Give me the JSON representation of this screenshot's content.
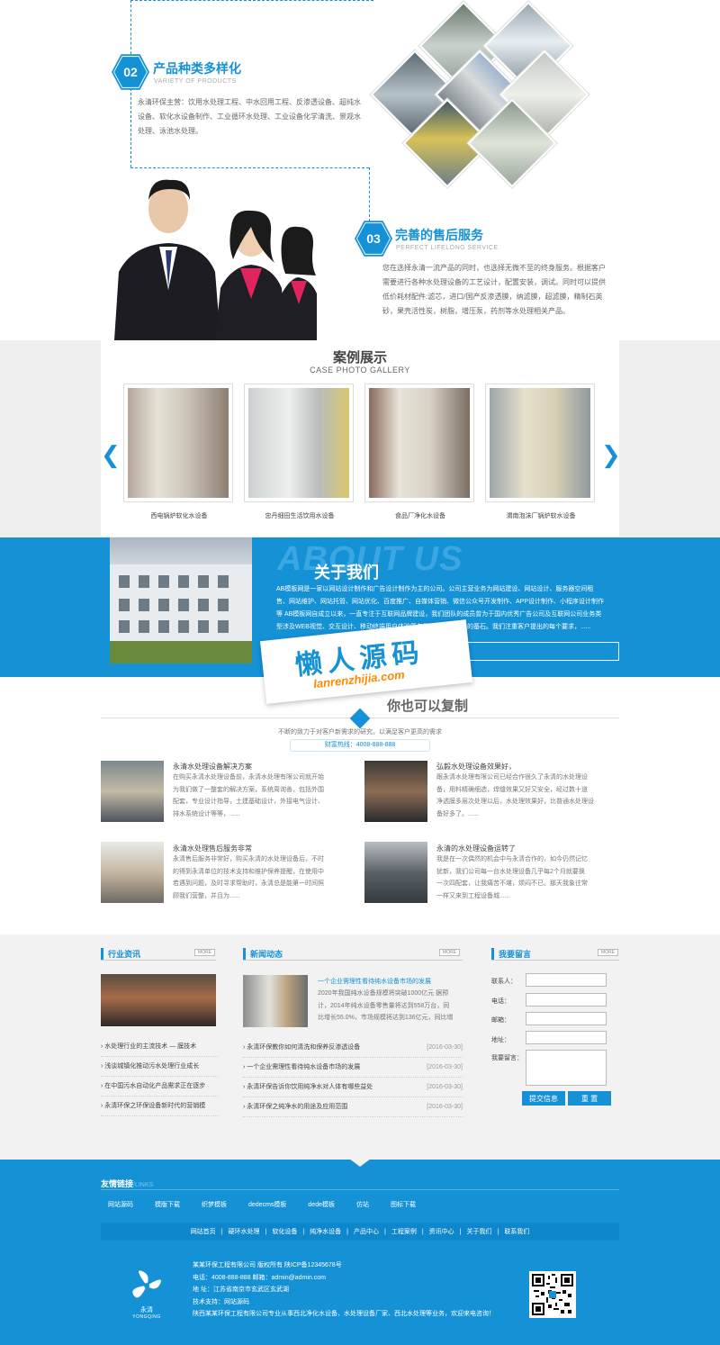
{
  "features": {
    "f2": {
      "num": "02",
      "title": "产品种类多样化",
      "sub": "VARIETY OF PRODUCTS",
      "text1": "永清环保主营：饮用水处理工程、中水回用工程、反渗透设备、超纯水",
      "text2": "设备、软化水设备制作、工业循环水处理、工业设备化学清洗、景观水",
      "text3": "处理、泳池水处理。"
    },
    "f3": {
      "num": "03",
      "title": "完善的售后服务",
      "sub": "PERFECT LIFELONG SERVICE",
      "text1": "您在选择永清一流产品的同时，也选择无微不至的终身服务。根据客户",
      "text2": "需要进行各种水处理设备的工艺设计，配置安装，调试。同时可以提供",
      "text3": "低价耗材配件:滤芯，进口/国产反渗透膜，纳滤膜，超滤膜，精制石英",
      "text4": "砂，果壳活性炭，树脂，增压泵，药剂等水处理相关产品。"
    }
  },
  "cases": {
    "title": "案例展示",
    "subtitle": "CASE PHOTO GALLERY",
    "items": [
      {
        "caption": "西电锅炉软化水设备"
      },
      {
        "caption": "忠丹细田生活饮用水设备"
      },
      {
        "caption": "食品厂净化水设备"
      },
      {
        "caption": "渭南泡沫厂锅炉软水设备"
      }
    ]
  },
  "about": {
    "bg": "ABOUT US",
    "title": "关于我们",
    "line1": "AB模板网是一家以网站设计制作和广告设计制作为主的公司。公司主营业务为网站建设、网站设计、服务器空间租",
    "line2": "售、网站维护、网站托管、网站优化、百度推广、自媒体营销、微信公众号开发制作、APP设计制作、小程序设计制作",
    "line3": "等 AB模板网自成立以来，一直专注于互联网品牌建设，我们团队的成员曾为于国内优秀广告公司及互联网公司业务类",
    "line4": "型涉及WEB视觉、交互设计、移动终端用户体验等各服务包括们存在的基石。我们注重客户提出的每个要求，......"
  },
  "watermark": {
    "title": "懒人源码",
    "url": "lanrenzhijia.com"
  },
  "news_section": {
    "title": "你也可以复制",
    "sub": "不断的致力于对客户新需求的研究，以满足客户更高的需求",
    "hotline": "财富热线：4008-888-888",
    "items": [
      {
        "title": "永清水处理设备解决方案",
        "l1": "在购买永清水处理设备前，永清水处理有限公司就开始",
        "l2": "为我们做了一整套的解决方案，系统周询善，包括外围",
        "l3": "配套，专业设计指导，土建基础设计，外接电气设计、",
        "l4": "排水系统设计等等，......"
      },
      {
        "title": "弘毅水处理设备效果好，",
        "l1": "跟永清水处理有限公司已经合作很久了永清的水处理设",
        "l2": "备，用料精确细选，焊缝效果又好又安全，经过数十道",
        "l3": "净透膜多层次处理以后，水处理效果好，比普通水处理设",
        "l4": "备好多了。......"
      },
      {
        "title": "永清水处理售后服务非常",
        "l1": "永清售后服务非常好，购买永清的水处理设备后，不时",
        "l2": "的得到永清单位的技术支持和维护保养提醒，在使用中",
        "l3": "若遇到问题，及时寻求帮助时，永清总是能第一时间照",
        "l4": "顾我们营整，并且为......"
      },
      {
        "title": "永清的水处理设备运转了",
        "l1": "我是在一次偶然的机会中与永清合作的，如今仍然记忆",
        "l2": "犹新，我们公司每一台水处理设备几乎每2个月就要换",
        "l3": "一次四配套，让我痛苦不堪，烦闷不已。那天我象往常",
        "l4": "一样又来到工程设备城......"
      }
    ]
  },
  "industry": {
    "head": "行业资讯",
    "more": "MORE",
    "items": [
      "水处理行业的主流技术 — 膜技术",
      "浅谈城镇化推动污水处理行业成长",
      "在中国污水自动化产品需求正在逐步",
      "永清环保之环保设备新时代的营销模"
    ]
  },
  "company_news": {
    "head": "新闻动态",
    "more": "MORE",
    "featured_title": "一个企业需理性看待纯水设备市场的发展",
    "f1": "2020年我国纯水设备规模将突破1000亿元 据预",
    "f2": "计，2014年纯水设备零售量将达到558万台，同",
    "f3": "比增长55.0%，市场规模将达到136亿元，同比增",
    "items": [
      {
        "text": "永清环保教你如何清洗和保养反渗透设备",
        "date": "[2016-03-30]"
      },
      {
        "text": "一个企业需理性看待纯水设备市场的发展",
        "date": "[2016-03-30]"
      },
      {
        "text": "永清环保告诉你饮用纯净水对人体有哪些益处",
        "date": "[2016-03-30]"
      },
      {
        "text": "永清环保之纯净水的用途及应用范围",
        "date": "[2016-03-30]"
      }
    ]
  },
  "message": {
    "head": "我要留言",
    "more": "MORE",
    "contact": "联系人：",
    "phone": "电话：",
    "email": "邮箱：",
    "address": "地址：",
    "msg": "我要留言：",
    "submit": "提交信息",
    "reset": "重 置"
  },
  "footer": {
    "links_head": "友情链接",
    "links_sub": "/LINKS",
    "links": [
      "网站源码",
      "模版下载",
      "织梦模板",
      "dedecms模板",
      "dede模板",
      "仿站",
      "图标下载"
    ],
    "nav": [
      "网站首页",
      "硬环水处理",
      "软化设备",
      "纯净水设备",
      "产品中心",
      "工程案例",
      "资讯中心",
      "关于我们",
      "联系我们"
    ],
    "logo_name": "永清",
    "logo_sub": "YONGQING",
    "line1": "某某环保工程有限公司 版权所有    陕ICP备12345678号",
    "line2": "电话：4008-888-888      邮箱：admin@admin.com",
    "line3": "地 址：江苏省南京市玄武区玄武湖",
    "line4": "技术支持：网站源码",
    "line5": "陕西某某环保工程有限公司专业从事西北净化水设备、水处理设备厂家、西北水处理等业务，欢迎来电咨询！"
  },
  "colors": {
    "accent": "#1591d6",
    "dark_accent": "#0f87cc"
  }
}
